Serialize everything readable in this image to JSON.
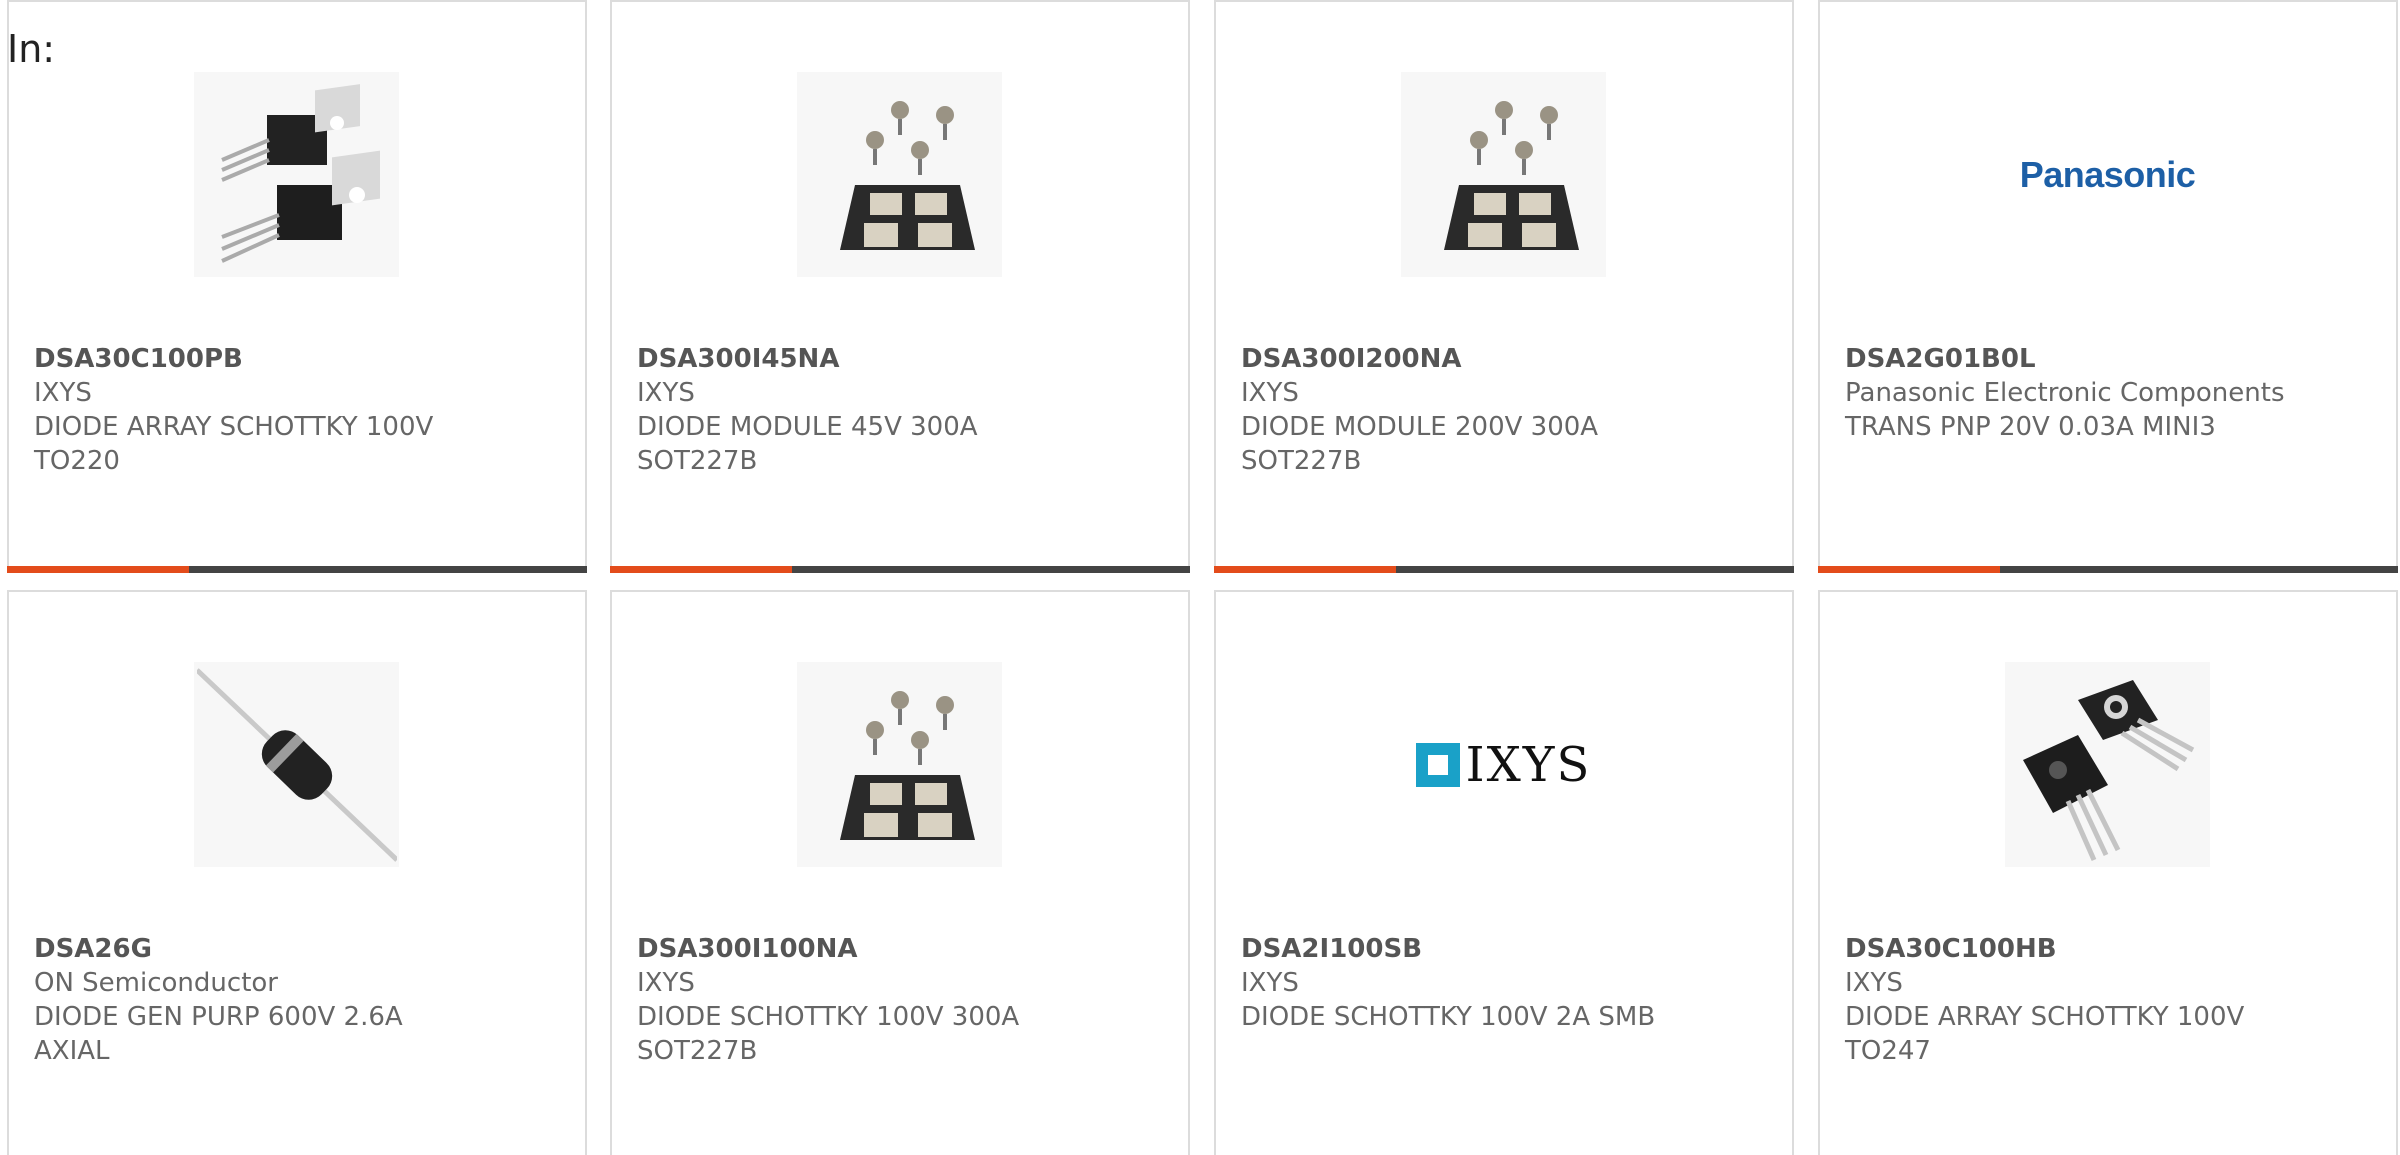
{
  "header": {
    "in_label": "In:"
  },
  "products": [
    {
      "part_number": "DSA30C100PB",
      "manufacturer": "IXYS",
      "description_line1": "DIODE ARRAY SCHOTTKY 100V",
      "description_line2": "TO220",
      "image_icon": "to220-package-icon"
    },
    {
      "part_number": "DSA300I45NA",
      "manufacturer": "IXYS",
      "description_line1": "DIODE MODULE 45V 300A",
      "description_line2": "SOT227B",
      "image_icon": "sot227b-module-icon"
    },
    {
      "part_number": "DSA300I200NA",
      "manufacturer": "IXYS",
      "description_line1": "DIODE MODULE 200V 300A",
      "description_line2": "SOT227B",
      "image_icon": "sot227b-module-icon"
    },
    {
      "part_number": "DSA2G01B0L",
      "manufacturer": "Panasonic Electronic Components",
      "description_line1": "TRANS PNP 20V 0.03A MINI3",
      "description_line2": "",
      "image_icon": "panasonic-logo",
      "logo_text": "Panasonic"
    },
    {
      "part_number": "DSA26G",
      "manufacturer": "ON Semiconductor",
      "description_line1": "DIODE GEN PURP 600V 2.6A",
      "description_line2": "AXIAL",
      "image_icon": "axial-diode-icon"
    },
    {
      "part_number": "DSA300I100NA",
      "manufacturer": "IXYS",
      "description_line1": "DIODE SCHOTTKY 100V 300A",
      "description_line2": "SOT227B",
      "image_icon": "sot227b-module-icon"
    },
    {
      "part_number": "DSA2I100SB",
      "manufacturer": "IXYS",
      "description_line1": "DIODE SCHOTTKY 100V 2A SMB",
      "description_line2": "",
      "image_icon": "ixys-logo",
      "logo_text": "IXYS"
    },
    {
      "part_number": "DSA30C100HB",
      "manufacturer": "IXYS",
      "description_line1": "DIODE ARRAY SCHOTTKY 100V",
      "description_line2": "TO247",
      "image_icon": "to247-package-icon"
    }
  ],
  "colors": {
    "accent": "#e34c1b",
    "bar": "#444444",
    "border": "#dcdcdc",
    "text": "#666666"
  }
}
